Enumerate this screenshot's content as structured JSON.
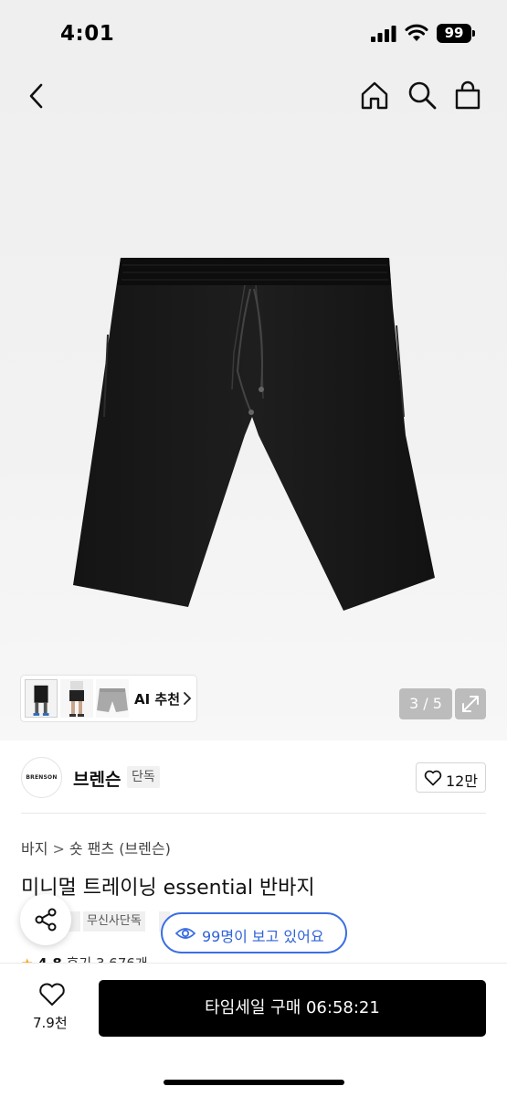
{
  "status_bar": {
    "time": "4:01",
    "battery": "99"
  },
  "product_image": {
    "page_counter": "3 / 5",
    "ai_recommend_label": "AI 추천",
    "image_description_icon": "black-shorts"
  },
  "brand": {
    "logo_text": "BRENSON",
    "name": "브렌슨",
    "badge": "단독",
    "likes": "12만"
  },
  "breadcrumb": [
    "바지",
    "숏 팬츠 (브렌슨)"
  ],
  "product": {
    "title": "미니멀 트레이닝 essential 반바지",
    "tags": [
      "무신사단독"
    ],
    "rating": "4.8",
    "reviews": "후기 3,676개"
  },
  "viewers": {
    "text": "99명이 보고 있어요"
  },
  "bottom": {
    "wish_count": "7.9천",
    "buy_label": "타임세일 구매 06:58:21"
  },
  "colors": {
    "accent_blue": "#3b6fe3",
    "buy_button": "#000000",
    "star": "#f5a623"
  },
  "icons": [
    "back-icon",
    "home-icon",
    "search-icon",
    "bag-icon",
    "expand-icon",
    "heart-icon",
    "share-icon",
    "eye-icon",
    "chevron-right-icon"
  ]
}
